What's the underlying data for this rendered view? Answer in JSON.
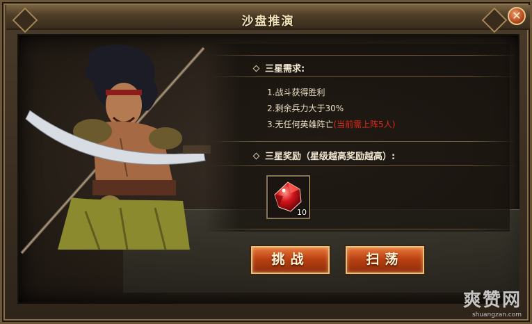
{
  "window": {
    "title": "沙盘推演",
    "close_symbol": "✕"
  },
  "requirements": {
    "heading": "三星需求:",
    "items": [
      {
        "text": "1.战斗获得胜利",
        "note": ""
      },
      {
        "text": "2.剩余兵力大于30%",
        "note": ""
      },
      {
        "text": "3.无任何英雄阵亡",
        "note": "(当前需上阵5人)"
      }
    ]
  },
  "rewards": {
    "heading": "三星奖励（星级越高奖励越高）:",
    "items": [
      {
        "icon": "red-gem-icon",
        "count": "10"
      }
    ]
  },
  "buttons": {
    "challenge": "挑战",
    "sweep": "扫荡"
  },
  "watermark": {
    "main": "爽赞网",
    "sub": "shuangzan.com"
  },
  "colors": {
    "note_red": "#e02a1a",
    "button_orange": "#c24a16",
    "title_gold": "#f3e3b8"
  }
}
